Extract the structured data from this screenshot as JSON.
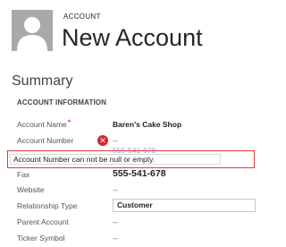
{
  "header": {
    "entity_type": "ACCOUNT",
    "record_title": "New Account",
    "avatar_icon": "person-silhouette-icon"
  },
  "section": {
    "title": "Summary",
    "group_title": "ACCOUNT INFORMATION"
  },
  "fields": {
    "account_name": {
      "label": "Account Name",
      "required_marker": "*",
      "value": "Baren's Cake Shop"
    },
    "account_number": {
      "label": "Account Number",
      "value": "--",
      "error_icon": "error-x-icon"
    },
    "obscured_phone": "555-541-678",
    "fax": {
      "label": "Fax",
      "value": "555-541-678"
    },
    "website": {
      "label": "Website",
      "value": "--"
    },
    "relationship_type": {
      "label": "Relationship Type",
      "value": "Customer"
    },
    "parent_account": {
      "label": "Parent Account",
      "value": "--"
    },
    "ticker_symbol": {
      "label": "Ticker Symbol",
      "value": "--"
    }
  },
  "error": {
    "message": "Account Number can not be null or empty."
  },
  "colors": {
    "error_red": "#d9232e",
    "error_border": "#e03c3c",
    "avatar_gray": "#a9a9a9"
  }
}
